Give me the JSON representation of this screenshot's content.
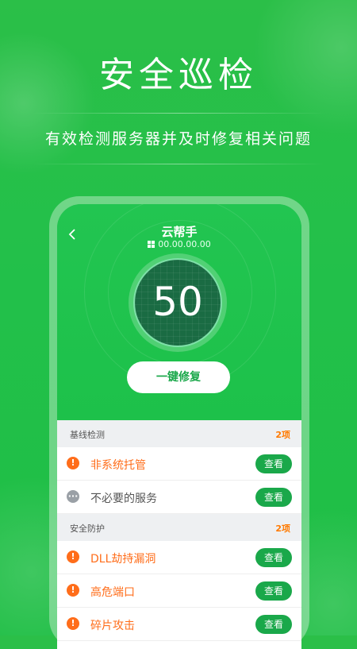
{
  "hero": {
    "title": "安全巡检",
    "subtitle": "有效检测服务器并及时修复相关问题"
  },
  "phone": {
    "app_title": "云帮手",
    "ip": "00.00.00.00",
    "score": "50",
    "repair_button": "一键修复"
  },
  "sections": [
    {
      "label": "基线检测",
      "count": "2项",
      "items": [
        {
          "text": "非系统托管",
          "status": "warn",
          "button": "查看"
        },
        {
          "text": "不必要的服务",
          "status": "info",
          "button": "查看"
        }
      ]
    },
    {
      "label": "安全防护",
      "count": "2项",
      "items": [
        {
          "text": "DLL劫持漏洞",
          "status": "warn",
          "button": "查看"
        },
        {
          "text": "高危端口",
          "status": "warn",
          "button": "查看"
        },
        {
          "text": "碎片攻击",
          "status": "warn",
          "button": "查看"
        }
      ]
    }
  ],
  "colors": {
    "brand_green": "#22c04a",
    "button_green": "#1aa84a",
    "warning_orange": "#ff6d1a",
    "score_circle": "#1a6b43"
  },
  "icons": {
    "back": "chevron-left-icon",
    "os": "windows-icon",
    "warning": "exclamation-icon",
    "info": "ellipsis-icon"
  }
}
